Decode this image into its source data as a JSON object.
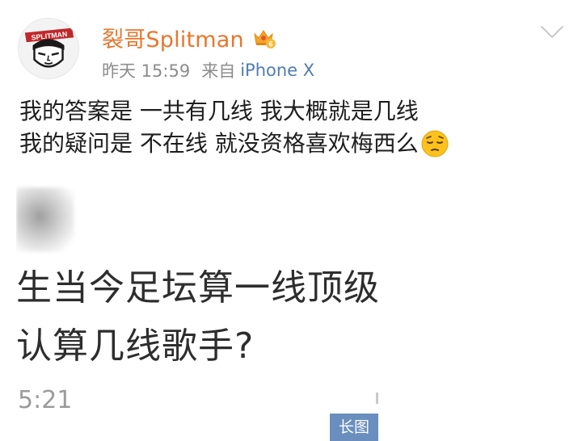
{
  "post": {
    "username": "裂哥Splitman",
    "time": "昨天 15:59",
    "source_prefix": "来自",
    "device": "iPhone X",
    "text_line1": "我的答案是 一共有几线 我大概就是几线",
    "text_line2": "我的疑问是 不在线 就没资格喜欢梅西么",
    "emoji": "pensive-face",
    "avatar_logo_text": "SPLITMAN",
    "vip_level": "6"
  },
  "image": {
    "line1": "生当今足坛算一线顶级",
    "line2": "认算几线歌手?",
    "time_fragment": "5:21",
    "long_image_badge": "长图"
  },
  "colors": {
    "username": "#e8762c",
    "device_link": "#4f7cb6",
    "meta_gray": "#8c8c8c",
    "badge_bg": "#6a8fbe"
  }
}
